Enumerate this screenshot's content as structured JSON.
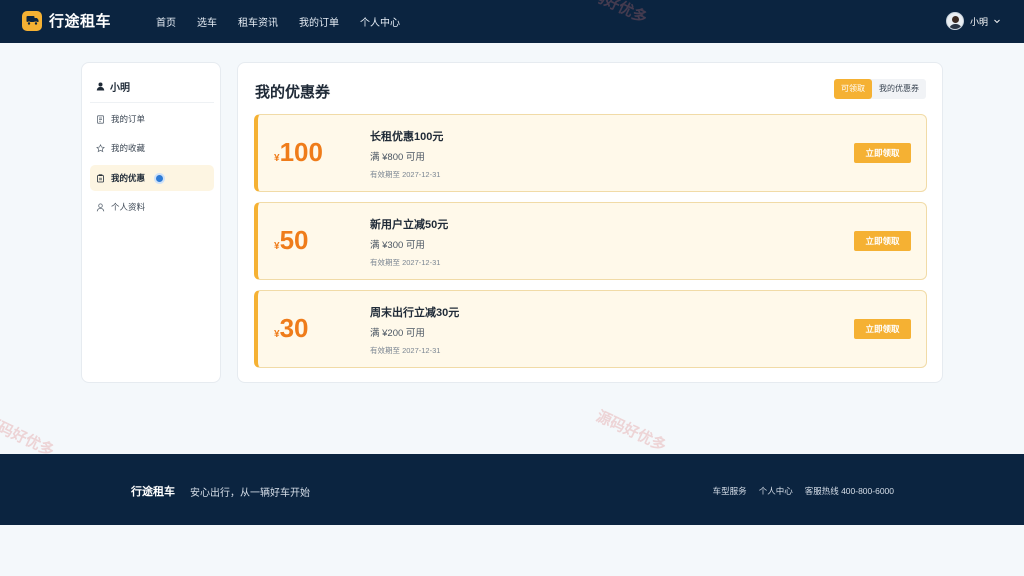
{
  "brand": {
    "name": "行途租车",
    "color": "#f5b133"
  },
  "nav": {
    "items": [
      "首页",
      "选车",
      "租车资讯",
      "我的订单",
      "个人中心"
    ]
  },
  "user": {
    "name": "小明"
  },
  "sidebar": {
    "username": "小明",
    "items": [
      {
        "label": "我的订单",
        "icon": "document-icon"
      },
      {
        "label": "我的收藏",
        "icon": "star-icon"
      },
      {
        "label": "我的优惠",
        "icon": "coupon-icon",
        "active": true
      },
      {
        "label": "个人资料",
        "icon": "person-icon"
      }
    ]
  },
  "main": {
    "title": "我的优惠券",
    "tabs": [
      "可领取",
      "我的优惠券"
    ],
    "active_tab": "可领取"
  },
  "coupons": [
    {
      "currency": "¥",
      "amount": "100",
      "title": "长租优惠100元",
      "condition": "满 ¥800 可用",
      "expiry": "有效期至 2027-12-31",
      "button": "立即领取"
    },
    {
      "currency": "¥",
      "amount": "50",
      "title": "新用户立减50元",
      "condition": "满 ¥300 可用",
      "expiry": "有效期至 2027-12-31",
      "button": "立即领取"
    },
    {
      "currency": "¥",
      "amount": "30",
      "title": "周末出行立减30元",
      "condition": "满 ¥200 可用",
      "expiry": "有效期至 2027-12-31",
      "button": "立即领取"
    }
  ],
  "footer": {
    "brand": "行途租车",
    "slogan": "安心出行，从一辆好车开始",
    "links": [
      "车型服务",
      "个人中心",
      "客服热线 400-800-6000"
    ]
  },
  "watermark": "源码好优多",
  "colors": {
    "nav_bg": "#0b2440",
    "accent": "#f5b133",
    "amount": "#ef7c1a",
    "coupon_bg": "#fff9ea"
  }
}
